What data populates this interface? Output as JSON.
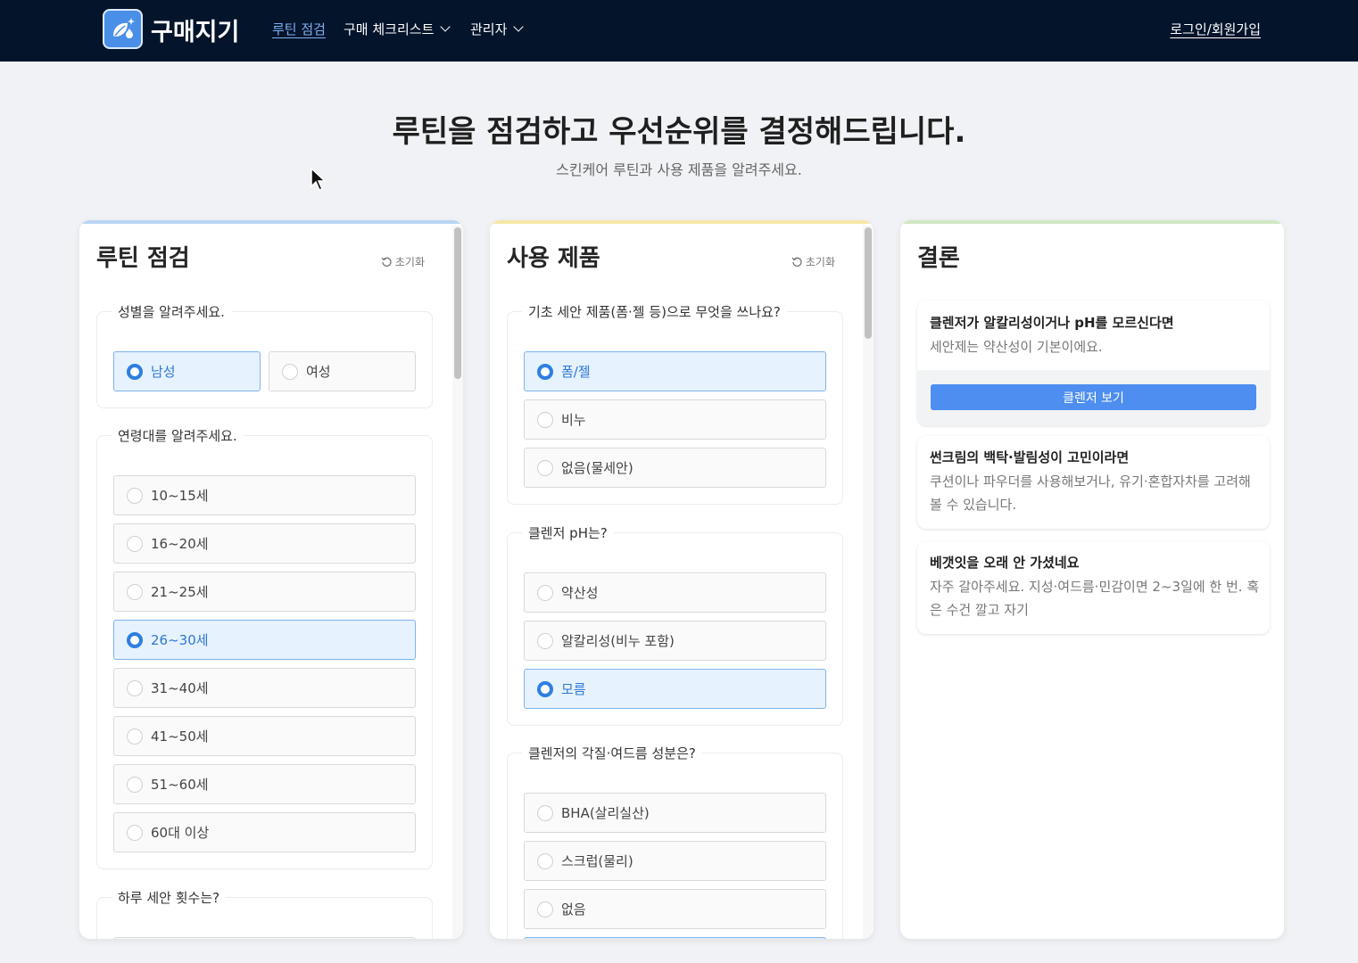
{
  "nav": {
    "brand": "구매지기",
    "links": [
      {
        "label": "루틴 점검",
        "active": true
      },
      {
        "label": "구매 체크리스트"
      },
      {
        "label": "관리자"
      }
    ],
    "login": "로그인/회원가입"
  },
  "hero": {
    "title": "루틴을 점검하고 우선순위를 결정해드립니다.",
    "subtitle": "스킨케어 루틴과 사용 제품을 알려주세요."
  },
  "routine": {
    "title": "루틴 점검",
    "reset": "초기화",
    "gender": {
      "question": "성별을 알려주세요.",
      "options": [
        "남성",
        "여성"
      ],
      "selected": "남성"
    },
    "age": {
      "question": "연령대를 알려주세요.",
      "options": [
        "10~15세",
        "16~20세",
        "21~25세",
        "26~30세",
        "31~40세",
        "41~50세",
        "51~60세",
        "60대 이상"
      ],
      "selected": "26~30세"
    },
    "wash_count": {
      "question": "하루 세안 횟수는?"
    }
  },
  "products": {
    "title": "사용 제품",
    "reset": "초기화",
    "cleanser_type": {
      "question": "기초 세안 제품(폼·젤 등)으로 무엇을 쓰나요?",
      "options": [
        "폼/젤",
        "비누",
        "없음(물세안)"
      ],
      "selected": "폼/젤"
    },
    "ph": {
      "question": "클렌저 pH는?",
      "options": [
        "약산성",
        "알칼리성(비누 포함)",
        "모름"
      ],
      "selected": "모름"
    },
    "ingredients": {
      "question": "클렌저의 각질·여드름 성분은?",
      "options": [
        "BHA(살리실산)",
        "스크럽(물리)",
        "없음"
      ]
    }
  },
  "conclusion": {
    "title": "결론",
    "cards": [
      {
        "title": "클렌저가 알칼리성이거나 pH를 모르신다면",
        "body": "세안제는 약산성이 기본이에요.",
        "button": "클렌저 보기"
      },
      {
        "title": "썬크림의 백탁·발림성이 고민이라면",
        "body": "쿠션이나 파우더를 사용해보거나, 유기·혼합자차를 고려해볼 수 있습니다."
      },
      {
        "title": "베갯잇을 오래 안 가셨네요",
        "body": "자주 갈아주세요. 지성·여드름·민감이면 2~3일에 한 번. 혹은 수건 깔고 자기"
      }
    ]
  },
  "colors": {
    "nav_bg": "#03142b",
    "accent": "#2e7fe0",
    "stripe_routine": "#b9d5f2",
    "stripe_products": "#f6e7a8",
    "stripe_conclusion": "#cfe8c4"
  }
}
